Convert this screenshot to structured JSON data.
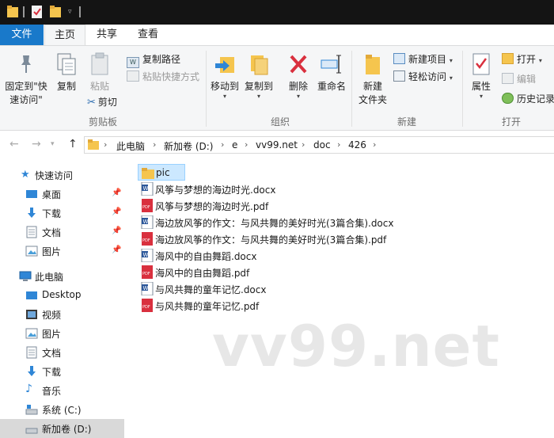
{
  "ribbon_tabs": {
    "file": "文件",
    "home": "主页",
    "share": "共享",
    "view": "查看"
  },
  "clipboard": {
    "pin_quick_access": [
      "固定到\"快",
      "速访问\""
    ],
    "copy": "复制",
    "paste": "粘贴",
    "copy_path": "复制路径",
    "paste_shortcut": "粘贴快捷方式",
    "cut": "剪切",
    "group_label": "剪贴板"
  },
  "organize": {
    "move_to": "移动到",
    "copy_to": "复制到",
    "delete": "删除",
    "rename": "重命名",
    "group_label": "组织"
  },
  "new_group": {
    "new_folder": [
      "新建",
      "文件夹"
    ],
    "new_item": "新建项目",
    "easy_access": "轻松访问",
    "group_label": "新建"
  },
  "open_group": {
    "properties": "属性",
    "open": "打开",
    "edit": "编辑",
    "history": "历史记录",
    "group_label": "打开"
  },
  "breadcrumb": {
    "items": [
      "此电脑",
      "新加卷 (D:)",
      "e",
      "vv99.net",
      "doc",
      "426"
    ]
  },
  "nav_pane": {
    "quick_access": "快速访问",
    "items_pinned": [
      "桌面",
      "下载",
      "文档",
      "图片"
    ],
    "this_pc": "此电脑",
    "pc_items": [
      "Desktop",
      "视频",
      "图片",
      "文档",
      "下载",
      "音乐",
      "系统 (C:)",
      "新加卷 (D:)"
    ]
  },
  "files": [
    {
      "name": "pic",
      "type": "folder"
    },
    {
      "name": "风筝与梦想的海边时光.docx",
      "type": "docx"
    },
    {
      "name": "风筝与梦想的海边时光.pdf",
      "type": "pdf"
    },
    {
      "name": "海边放风筝的作文：与风共舞的美好时光(3篇合集).docx",
      "type": "docx"
    },
    {
      "name": "海边放风筝的作文：与风共舞的美好时光(3篇合集).pdf",
      "type": "pdf"
    },
    {
      "name": "海风中的自由舞蹈.docx",
      "type": "docx"
    },
    {
      "name": "海风中的自由舞蹈.pdf",
      "type": "pdf"
    },
    {
      "name": "与风共舞的童年记忆.docx",
      "type": "docx"
    },
    {
      "name": "与风共舞的童年记忆.pdf",
      "type": "pdf"
    }
  ],
  "watermark": "vv99.net",
  "colors": {
    "accent": "#1979ca",
    "folder": "#f5c54e",
    "pdf": "#d9303e",
    "docx": "#2b579a",
    "selection": "#cce8ff"
  }
}
